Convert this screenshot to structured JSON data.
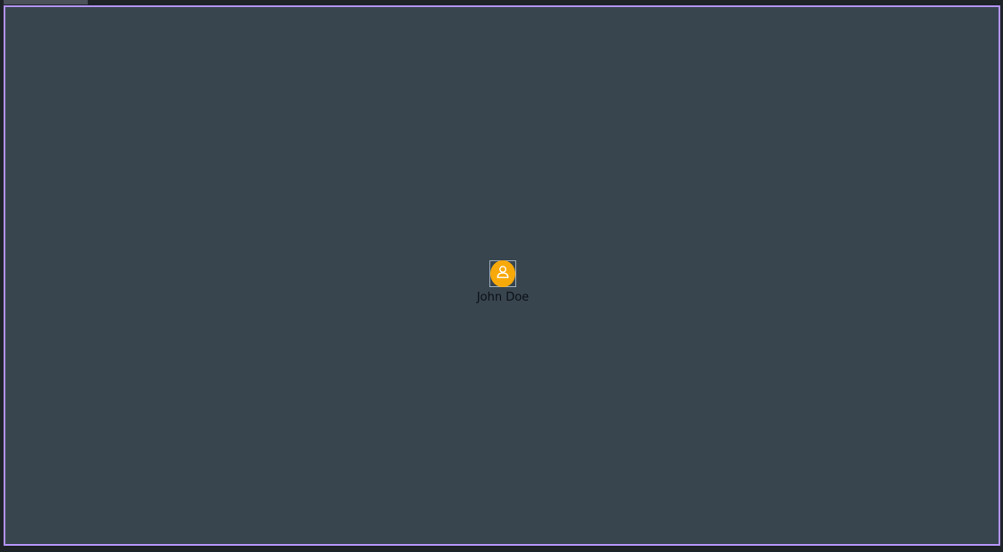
{
  "canvas": {
    "background_color": "#38454f",
    "border_color": "#b493f5"
  },
  "top_tab": {
    "color": "#4b525a"
  },
  "user_node": {
    "name": "John Doe",
    "icon": "user-icon",
    "avatar_color": "#f8a90a"
  }
}
